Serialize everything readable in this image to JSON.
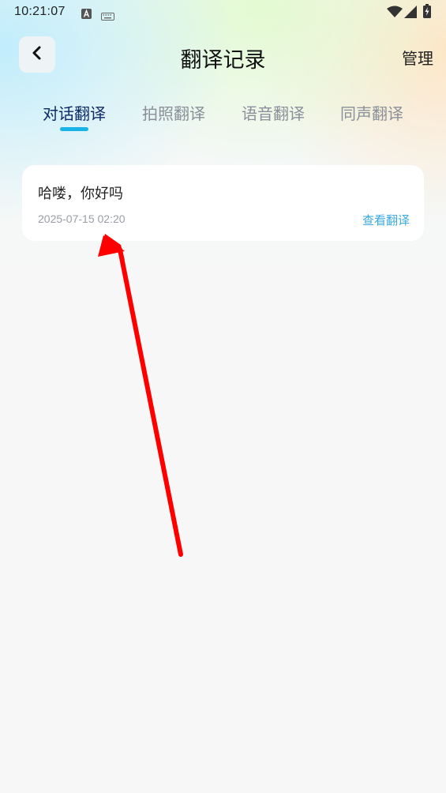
{
  "status_bar": {
    "time": "10:21:07",
    "icons": [
      "app-notification-icon",
      "keyboard-icon",
      "wifi-icon",
      "signal-icon",
      "battery-icon"
    ]
  },
  "header": {
    "title": "翻译记录",
    "manage_label": "管理"
  },
  "tabs": [
    {
      "label": "对话翻译",
      "active": true
    },
    {
      "label": "拍照翻译",
      "active": false
    },
    {
      "label": "语音翻译",
      "active": false
    },
    {
      "label": "同声翻译",
      "active": false
    }
  ],
  "records": [
    {
      "text": "哈喽，你好吗",
      "timestamp": "2025-07-15 02:20",
      "action_label": "查看翻译"
    }
  ],
  "colors": {
    "accent": "#18b4e8",
    "active_tab": "#0e2a66",
    "inactive_tab": "#8a8f99",
    "link": "#3aa9e0",
    "annotation_arrow": "#ff0000"
  }
}
